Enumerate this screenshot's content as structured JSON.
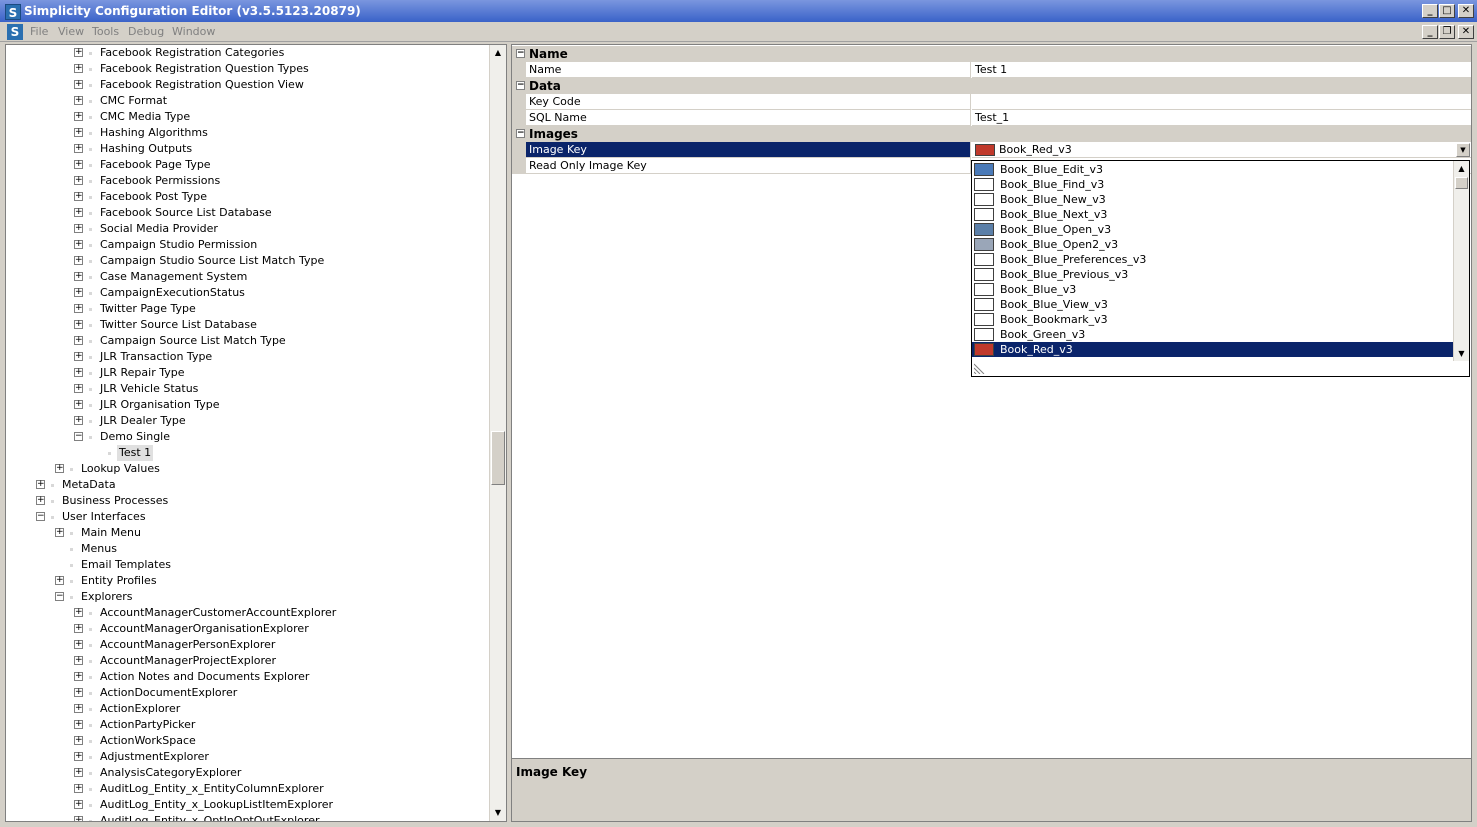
{
  "window": {
    "title": "Simplicity Configuration Editor (v3.5.5123.20879)"
  },
  "menu": {
    "items": [
      "File",
      "View",
      "Tools",
      "Debug",
      "Window"
    ]
  },
  "tree": {
    "rows": [
      {
        "label": "Facebook Registration Categories",
        "depth": 3,
        "expander": "+"
      },
      {
        "label": "Facebook Registration Question Types",
        "depth": 3,
        "expander": "+"
      },
      {
        "label": "Facebook Registration Question View",
        "depth": 3,
        "expander": "+"
      },
      {
        "label": "CMC Format",
        "depth": 3,
        "expander": "+"
      },
      {
        "label": "CMC Media Type",
        "depth": 3,
        "expander": "+"
      },
      {
        "label": "Hashing Algorithms",
        "depth": 3,
        "expander": "+"
      },
      {
        "label": "Hashing Outputs",
        "depth": 3,
        "expander": "+"
      },
      {
        "label": "Facebook Page Type",
        "depth": 3,
        "expander": "+"
      },
      {
        "label": "Facebook Permissions",
        "depth": 3,
        "expander": "+"
      },
      {
        "label": "Facebook Post Type",
        "depth": 3,
        "expander": "+"
      },
      {
        "label": "Facebook Source List Database",
        "depth": 3,
        "expander": "+"
      },
      {
        "label": "Social Media Provider",
        "depth": 3,
        "expander": "+"
      },
      {
        "label": "Campaign Studio Permission",
        "depth": 3,
        "expander": "+"
      },
      {
        "label": "Campaign Studio Source List Match Type",
        "depth": 3,
        "expander": "+"
      },
      {
        "label": "Case Management System",
        "depth": 3,
        "expander": "+"
      },
      {
        "label": "CampaignExecutionStatus",
        "depth": 3,
        "expander": "+"
      },
      {
        "label": "Twitter Page Type",
        "depth": 3,
        "expander": "+"
      },
      {
        "label": "Twitter Source List Database",
        "depth": 3,
        "expander": "+"
      },
      {
        "label": "Campaign Source List Match Type",
        "depth": 3,
        "expander": "+"
      },
      {
        "label": "JLR Transaction Type",
        "depth": 3,
        "expander": "+"
      },
      {
        "label": "JLR Repair Type",
        "depth": 3,
        "expander": "+"
      },
      {
        "label": "JLR Vehicle Status",
        "depth": 3,
        "expander": "+"
      },
      {
        "label": "JLR Organisation Type",
        "depth": 3,
        "expander": "+"
      },
      {
        "label": "JLR Dealer Type",
        "depth": 3,
        "expander": "+"
      },
      {
        "label": "Demo Single",
        "depth": 3,
        "expander": "−"
      },
      {
        "label": "Test 1",
        "depth": 4,
        "expander": "",
        "selected": true
      },
      {
        "label": "Lookup Values",
        "depth": 2,
        "expander": "+"
      },
      {
        "label": "MetaData",
        "depth": 1,
        "expander": "+"
      },
      {
        "label": "Business Processes",
        "depth": 1,
        "expander": "+"
      },
      {
        "label": "User Interfaces",
        "depth": 1,
        "expander": "−"
      },
      {
        "label": "Main Menu",
        "depth": 2,
        "expander": "+"
      },
      {
        "label": "Menus",
        "depth": 2,
        "expander": ""
      },
      {
        "label": "Email Templates",
        "depth": 2,
        "expander": ""
      },
      {
        "label": "Entity Profiles",
        "depth": 2,
        "expander": "+"
      },
      {
        "label": "Explorers",
        "depth": 2,
        "expander": "−"
      },
      {
        "label": "AccountManagerCustomerAccountExplorer",
        "depth": 3,
        "expander": "+"
      },
      {
        "label": "AccountManagerOrganisationExplorer",
        "depth": 3,
        "expander": "+"
      },
      {
        "label": "AccountManagerPersonExplorer",
        "depth": 3,
        "expander": "+"
      },
      {
        "label": "AccountManagerProjectExplorer",
        "depth": 3,
        "expander": "+"
      },
      {
        "label": "Action Notes and Documents Explorer",
        "depth": 3,
        "expander": "+"
      },
      {
        "label": "ActionDocumentExplorer",
        "depth": 3,
        "expander": "+"
      },
      {
        "label": "ActionExplorer",
        "depth": 3,
        "expander": "+"
      },
      {
        "label": "ActionPartyPicker",
        "depth": 3,
        "expander": "+"
      },
      {
        "label": "ActionWorkSpace",
        "depth": 3,
        "expander": "+"
      },
      {
        "label": "AdjustmentExplorer",
        "depth": 3,
        "expander": "+"
      },
      {
        "label": "AnalysisCategoryExplorer",
        "depth": 3,
        "expander": "+"
      },
      {
        "label": "AuditLog_Entity_x_EntityColumnExplorer",
        "depth": 3,
        "expander": "+"
      },
      {
        "label": "AuditLog_Entity_x_LookupListItemExplorer",
        "depth": 3,
        "expander": "+"
      },
      {
        "label": "AuditLog_Entity_x_OptInOptOutExplorer",
        "depth": 3,
        "expander": "+"
      }
    ]
  },
  "properties": {
    "categories": [
      {
        "label": "Name",
        "rows": [
          {
            "name": "Name",
            "value": "Test 1"
          }
        ]
      },
      {
        "label": "Data",
        "rows": [
          {
            "name": "Key Code",
            "value": ""
          },
          {
            "name": "SQL Name",
            "value": "Test_1"
          }
        ]
      },
      {
        "label": "Images",
        "rows": [
          {
            "name": "Image Key",
            "value": "Book_Red_v3",
            "selected": true
          },
          {
            "name": "Read Only Image Key",
            "value": ""
          }
        ]
      }
    ]
  },
  "dropdown": {
    "items": [
      {
        "label": "Book_Blue_Edit_v3",
        "icon": "book-blue-edit-icon",
        "color": "#4a7ab8"
      },
      {
        "label": "Book_Blue_Find_v3",
        "icon": "blank-icon",
        "color": "#ffffff"
      },
      {
        "label": "Book_Blue_New_v3",
        "icon": "blank-icon",
        "color": "#ffffff"
      },
      {
        "label": "Book_Blue_Next_v3",
        "icon": "blank-icon",
        "color": "#ffffff"
      },
      {
        "label": "Book_Blue_Open_v3",
        "icon": "book-blue-open-icon",
        "color": "#5b7fa8"
      },
      {
        "label": "Book_Blue_Open2_v3",
        "icon": "book-blue-open2-icon",
        "color": "#9aa6b8"
      },
      {
        "label": "Book_Blue_Preferences_v3",
        "icon": "blank-icon",
        "color": "#ffffff"
      },
      {
        "label": "Book_Blue_Previous_v3",
        "icon": "blank-icon",
        "color": "#ffffff"
      },
      {
        "label": "Book_Blue_v3",
        "icon": "blank-icon",
        "color": "#ffffff"
      },
      {
        "label": "Book_Blue_View_v3",
        "icon": "blank-icon",
        "color": "#ffffff"
      },
      {
        "label": "Book_Bookmark_v3",
        "icon": "blank-icon",
        "color": "#ffffff"
      },
      {
        "label": "Book_Green_v3",
        "icon": "blank-icon",
        "color": "#ffffff"
      },
      {
        "label": "Book_Red_v3",
        "icon": "book-red-icon",
        "color": "#c0392b",
        "selected": true
      }
    ]
  },
  "help": {
    "title": "Image Key"
  },
  "colors": {
    "selection": "#0a246a",
    "red_swatch": "#c0392b"
  }
}
